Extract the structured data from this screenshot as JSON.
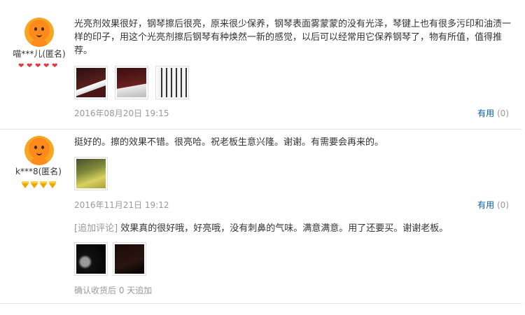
{
  "reviews": [
    {
      "username": "喵***儿(匿名)",
      "badge_type": "heart",
      "badge_count": 5,
      "content": "光亮剂效果很好，钢琴擦后很亮，原来很少保养，钢琴表面雾蒙蒙的没有光泽，琴键上也有很多污印和油渍一样的印子，用这个光亮剂擦后钢琴有种焕然一新的感觉，以后可以经常用它保养钢琴了，物有所值，值得推荐。",
      "photos": [
        "piano-photo-1",
        "piano-photo-2",
        "piano-keys-photo"
      ],
      "date": "2016年08月20日 19:15",
      "useful_label": "有用",
      "useful_count": "(0)"
    },
    {
      "username": "k***8(匿名)",
      "badge_type": "gem",
      "badge_count": 4,
      "content": "挺好的。擦的效果不错。很亮哈。祝老板生意兴隆。谢谢。有需要会再来的。",
      "photos": [
        "cloth-photo"
      ],
      "date": "2016年11月21日 19:12",
      "useful_label": "有用",
      "useful_count": "(0)",
      "followup_label": "[追加评论]",
      "followup_text": "效果真的很好哦，好亮哦，没有刺鼻的气味。满意满意。用了还要买。谢谢老板。",
      "followup_photos": [
        "dark-photo-1",
        "dark-photo-2"
      ],
      "confirm_text": "确认收货后 0 天追加"
    }
  ],
  "colors": {
    "link": "#005ea7",
    "muted": "#999999",
    "heart_badge": "#e4393c",
    "gem_badge": "#f4a300",
    "avatar": "#ff8a1c"
  }
}
